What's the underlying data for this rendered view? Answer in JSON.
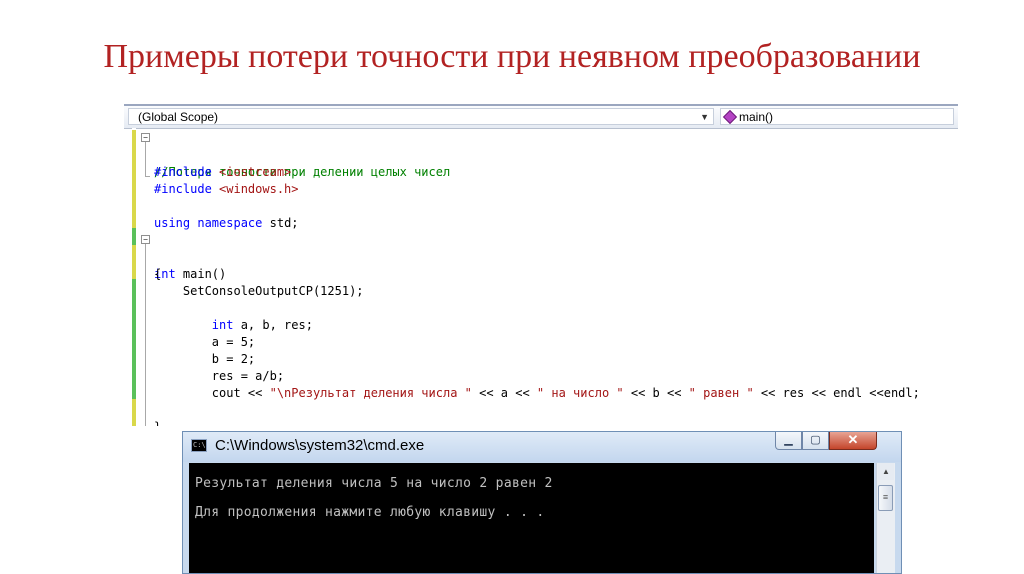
{
  "slide": {
    "title": "Примеры потери точности при неявном преобразовании"
  },
  "editor": {
    "scope_label": "(Global Scope)",
    "member_label": "main()",
    "code_lines": [
      "//Потеря точности при делении целых чисел",
      "#include <iostream>",
      "#include <windows.h>",
      "",
      "using namespace std;",
      "",
      "int main()",
      "{",
      "    SetConsoleOutputCP(1251);",
      "",
      "        int a, b, res;",
      "        a = 5;",
      "        b = 2;",
      "        res = a/b;",
      "        cout << \"\\nРезультат деления числа \" << a << \" на число \" << b << \" равен \" << res << endl <<endl;",
      "",
      "}"
    ],
    "colors": {
      "keyword": "#0000ff",
      "comment": "#008000",
      "string": "#a31515",
      "gutter_saved": "#5ac05a",
      "gutter_changed": "#d9d84a"
    }
  },
  "cmd_window": {
    "title": "C:\\Windows\\system32\\cmd.exe",
    "icon": "cmd-app-icon",
    "output": [
      "Результат деления числа 5 на число 2 равен 2",
      "Для продолжения нажмите любую клавишу . . ."
    ],
    "buttons": {
      "minimize_icon": "minimize-icon",
      "maximize_icon": "maximize-icon",
      "close_icon": "close-icon"
    }
  }
}
